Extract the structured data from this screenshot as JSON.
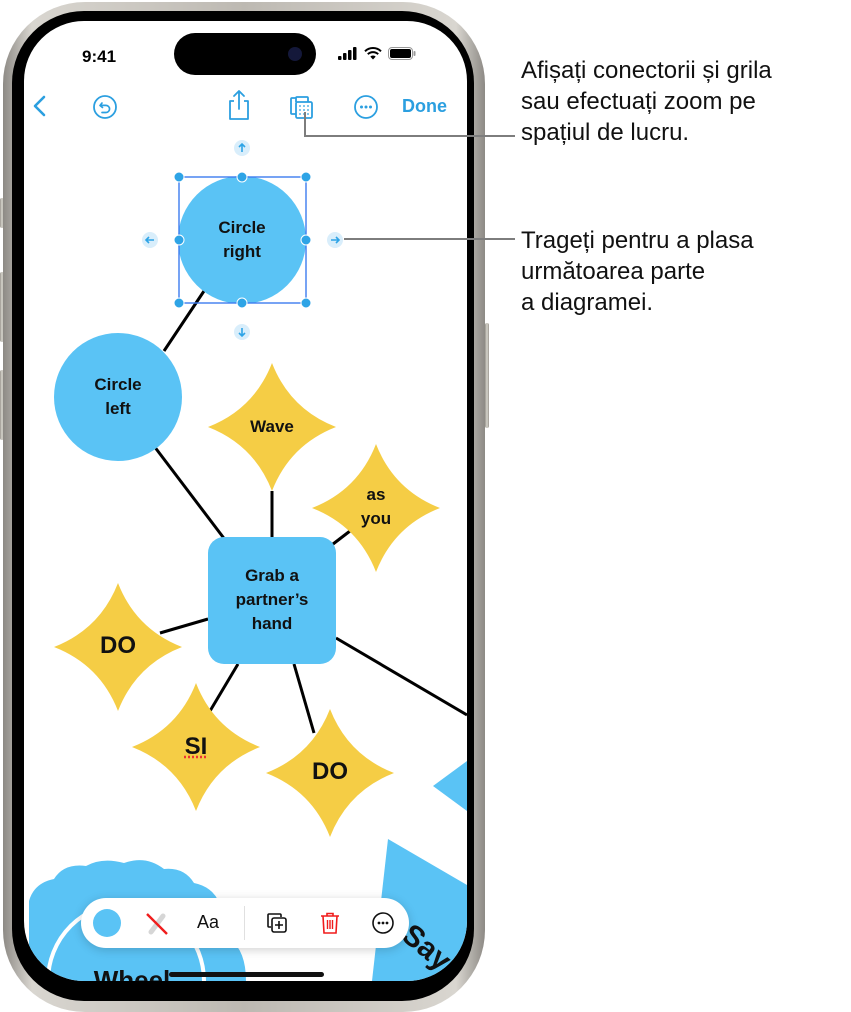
{
  "status_bar": {
    "time": "9:41"
  },
  "toolbar": {
    "back_icon": "chevron-left-icon",
    "undo_icon": "undo-icon",
    "share_icon": "share-icon",
    "view_options_icon": "grid-view-options-icon",
    "more_icon": "ellipsis-circle-icon",
    "done_label": "Done"
  },
  "diagram": {
    "nodes": [
      {
        "id": "circle-right",
        "shape": "circle",
        "text_lines": [
          "Circle",
          "right"
        ],
        "selected": true
      },
      {
        "id": "circle-left",
        "shape": "circle",
        "text_lines": [
          "Circle",
          "left"
        ]
      },
      {
        "id": "wave",
        "shape": "star",
        "text_lines": [
          "Wave"
        ]
      },
      {
        "id": "as-you",
        "shape": "star",
        "text_lines": [
          "as",
          "you"
        ]
      },
      {
        "id": "grab",
        "shape": "rounded-rect",
        "text_lines": [
          "Grab a",
          "partner’s",
          "hand"
        ]
      },
      {
        "id": "do-left",
        "shape": "star",
        "text_lines": [
          "DO"
        ]
      },
      {
        "id": "si",
        "shape": "star",
        "text_lines": [
          "SI"
        ]
      },
      {
        "id": "do-right",
        "shape": "star",
        "text_lines": [
          "DO"
        ]
      },
      {
        "id": "wheel",
        "shape": "cloud",
        "text_lines": [
          "Wheel"
        ]
      },
      {
        "id": "say",
        "shape": "triangle",
        "text_lines": [
          "Say"
        ]
      }
    ],
    "colors": {
      "blue": "#5ac3f5",
      "yellow": "#f5cd45",
      "selection": "#3d7cf0",
      "handle": "#2ea4e6"
    }
  },
  "format_bar": {
    "items": [
      {
        "name": "fill-color",
        "icon": "color-swatch-icon"
      },
      {
        "name": "stroke",
        "icon": "no-stroke-icon"
      },
      {
        "name": "text-style",
        "label": "Aa"
      },
      {
        "name": "duplicate",
        "icon": "duplicate-icon"
      },
      {
        "name": "delete",
        "icon": "trash-icon"
      },
      {
        "name": "more",
        "icon": "ellipsis-circle-icon"
      }
    ]
  },
  "callouts": {
    "top": [
      "Afișați conectorii și grila",
      "sau efectuați zoom pe",
      "spațiul de lucru."
    ],
    "middle": [
      "Trageți pentru a plasa",
      "următoarea parte",
      "a diagramei."
    ]
  }
}
